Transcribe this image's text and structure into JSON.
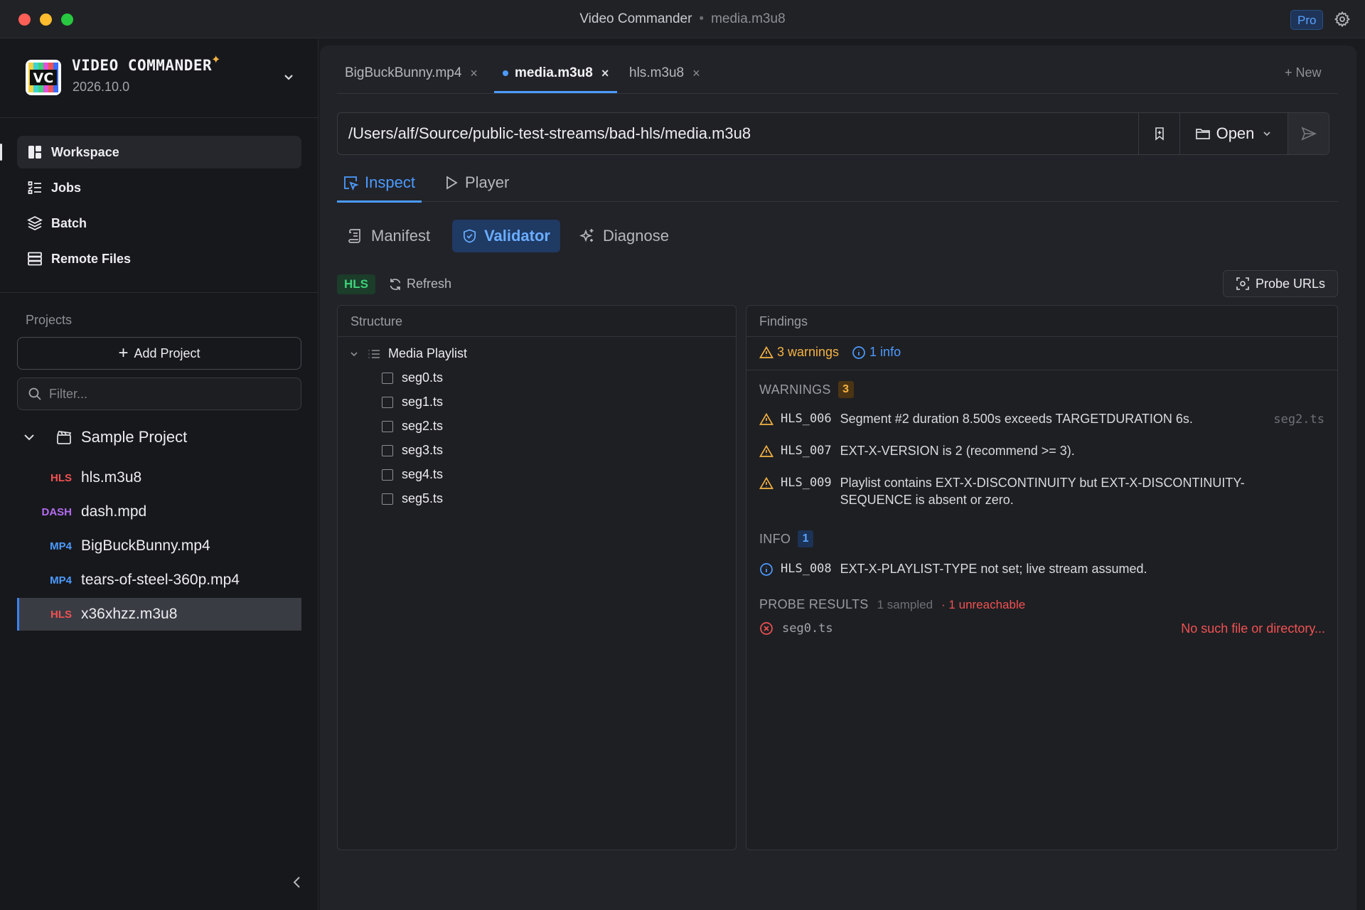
{
  "window": {
    "title": "Video Commander",
    "subtitle": "media.m3u8",
    "pro_badge": "Pro"
  },
  "app": {
    "name": "VIDEO COMMANDER",
    "version": "2026.10.0",
    "logo_text": "VC"
  },
  "nav": {
    "items": [
      {
        "label": "Workspace",
        "icon": "workspace-icon",
        "active": true
      },
      {
        "label": "Jobs",
        "icon": "jobs-icon",
        "active": false
      },
      {
        "label": "Batch",
        "icon": "layers-icon",
        "active": false
      },
      {
        "label": "Remote Files",
        "icon": "server-icon",
        "active": false
      }
    ]
  },
  "projects": {
    "label": "Projects",
    "add_label": "Add Project",
    "filter_placeholder": "Filter...",
    "project_name": "Sample Project",
    "files": [
      {
        "badge": "HLS",
        "name": "hls.m3u8"
      },
      {
        "badge": "DASH",
        "name": "dash.mpd"
      },
      {
        "badge": "MP4",
        "name": "BigBuckBunny.mp4"
      },
      {
        "badge": "MP4",
        "name": "tears-of-steel-360p.mp4"
      },
      {
        "badge": "HLS",
        "name": "x36xhzz.m3u8"
      }
    ]
  },
  "tabs": {
    "items": [
      {
        "label": "BigBuckBunny.mp4"
      },
      {
        "label": "media.m3u8"
      },
      {
        "label": "hls.m3u8"
      }
    ],
    "new_label": "+ New"
  },
  "url": {
    "value": "/Users/alf/Source/public-test-streams/bad-hls/media.m3u8",
    "open_label": "Open"
  },
  "main_tabs": {
    "inspect": "Inspect",
    "player": "Player"
  },
  "sub_tabs": {
    "manifest": "Manifest",
    "validator": "Validator",
    "diagnose": "Diagnose"
  },
  "toolbar": {
    "format_badge": "HLS",
    "refresh_label": "Refresh",
    "probe_label": "Probe URLs"
  },
  "structure": {
    "title": "Structure",
    "root": "Media Playlist",
    "segments": [
      "seg0.ts",
      "seg1.ts",
      "seg2.ts",
      "seg3.ts",
      "seg4.ts",
      "seg5.ts"
    ]
  },
  "findings": {
    "title": "Findings",
    "summary_warnings": "3 warnings",
    "summary_info": "1 info",
    "warnings_label": "WARNINGS",
    "warnings_count": "3",
    "warnings": [
      {
        "code": "HLS_006",
        "message": "Segment #2 duration 8.500s exceeds TARGETDURATION 6s.",
        "ref": "seg2.ts"
      },
      {
        "code": "HLS_007",
        "message": "EXT-X-VERSION is 2 (recommend >= 3).",
        "ref": ""
      },
      {
        "code": "HLS_009",
        "message": "Playlist contains EXT-X-DISCONTINUITY but EXT-X-DISCONTINUITY-SEQUENCE is absent or zero.",
        "ref": ""
      }
    ],
    "info_label": "INFO",
    "info_count": "1",
    "info": [
      {
        "code": "HLS_008",
        "message": "EXT-X-PLAYLIST-TYPE not set; live stream assumed."
      }
    ],
    "probe_label": "PROBE RESULTS",
    "probe_sampled": "1 sampled",
    "probe_unreachable": "· 1 unreachable",
    "probe_results": [
      {
        "file": "seg0.ts",
        "error": "No such file or directory..."
      }
    ]
  },
  "colors": {
    "accent": "#4c9bff",
    "warning": "#f5b342",
    "error": "#f05252",
    "hls": "#f05252",
    "dash": "#b56cf0",
    "mp4": "#4c9bff",
    "success": "#3ed27a"
  }
}
